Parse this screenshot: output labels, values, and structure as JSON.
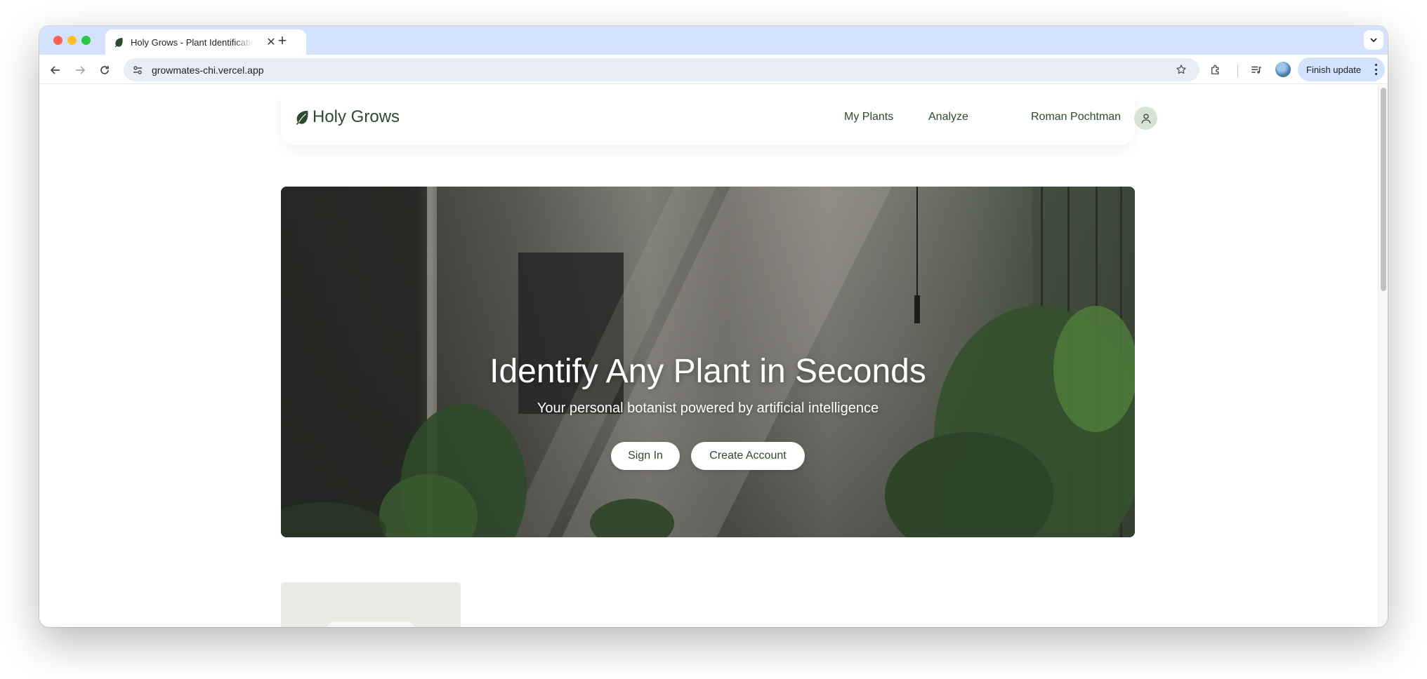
{
  "browser": {
    "tab": {
      "title": "Holy Grows - Plant Identification",
      "favicon": "leaf-icon"
    },
    "address_bar": {
      "url": "growmates-chi.vercel.app"
    },
    "finish_update_label": "Finish update"
  },
  "site": {
    "logo_text": "Holy Grows",
    "nav": {
      "my_plants": "My Plants",
      "analyze": "Analyze",
      "user_name": "Roman Pochtman"
    }
  },
  "hero": {
    "title": "Identify Any Plant in Seconds",
    "subtitle": "Your personal botanist powered by artificial intelligence",
    "sign_in_label": "Sign In",
    "create_account_label": "Create Account"
  },
  "colors": {
    "brand_green": "#2d4a2f",
    "tabstrip_blue": "#d3e3fd",
    "omnibox_bg": "#e9eef6"
  }
}
